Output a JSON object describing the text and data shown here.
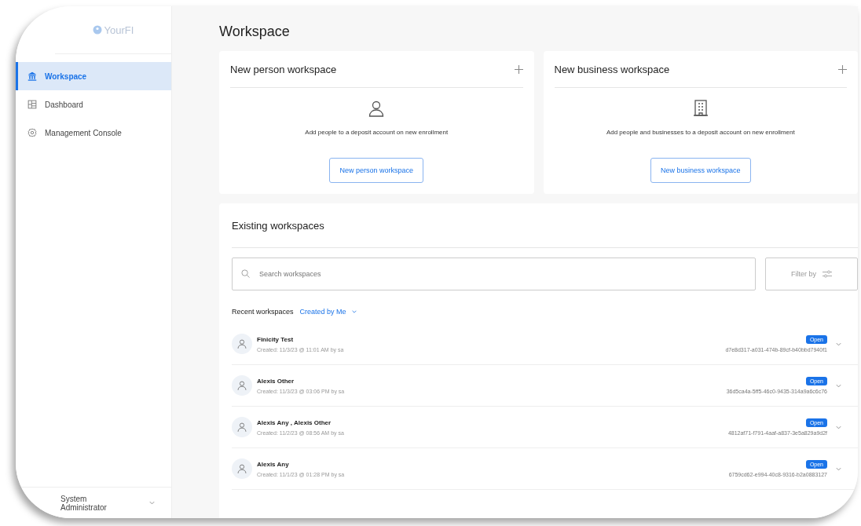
{
  "logo": {
    "text": "YourFI"
  },
  "sidebar": {
    "items": [
      {
        "label": "Workspace",
        "kind": "bank",
        "selected": true
      },
      {
        "label": "Dashboard",
        "kind": "grid",
        "selected": false
      },
      {
        "label": "Management Console",
        "kind": "gear",
        "selected": false
      }
    ],
    "user": {
      "name": "System Administrator"
    }
  },
  "page_title": "Workspace",
  "new_cards": [
    {
      "title": "New person workspace",
      "kind": "person",
      "description": "Add people to a deposit account on new enrollment",
      "button": "New person workspace"
    },
    {
      "title": "New business workspace",
      "kind": "building",
      "description": "Add people and businesses to a deposit account on new enrollment",
      "button": "New business workspace"
    }
  ],
  "existing": {
    "title": "Existing workspaces",
    "search": {
      "placeholder": "Search workspaces"
    },
    "filter_button": "Filter by",
    "recent_label": "Recent workspaces",
    "scope": "Created by Me",
    "rows": [
      {
        "name": "Finicity Test",
        "created": "Created: 11/3/23 @ 11:01 AM by sa",
        "status": "Open",
        "id": "d7e8d317-a031-474b-89cf-b40bbd7940f1"
      },
      {
        "name": "Alexis Other",
        "created": "Created: 11/3/23 @ 03:06 PM by sa",
        "status": "Open",
        "id": "36d5ca4a-5ff5-46c0-9435-314a9a6c6c76"
      },
      {
        "name": "Alexis Any , Alexis Other",
        "created": "Created: 11/2/23 @ 08:56 AM by sa",
        "status": "Open",
        "id": "4812af71-f791-4aaf-a837-3e5a829a9d2f"
      },
      {
        "name": "Alexis Any",
        "created": "Created: 11/1/23 @ 01:28 PM by sa",
        "status": "Open",
        "id": "6759cd62-e994-40c8-9316-b2a0883127"
      }
    ]
  }
}
